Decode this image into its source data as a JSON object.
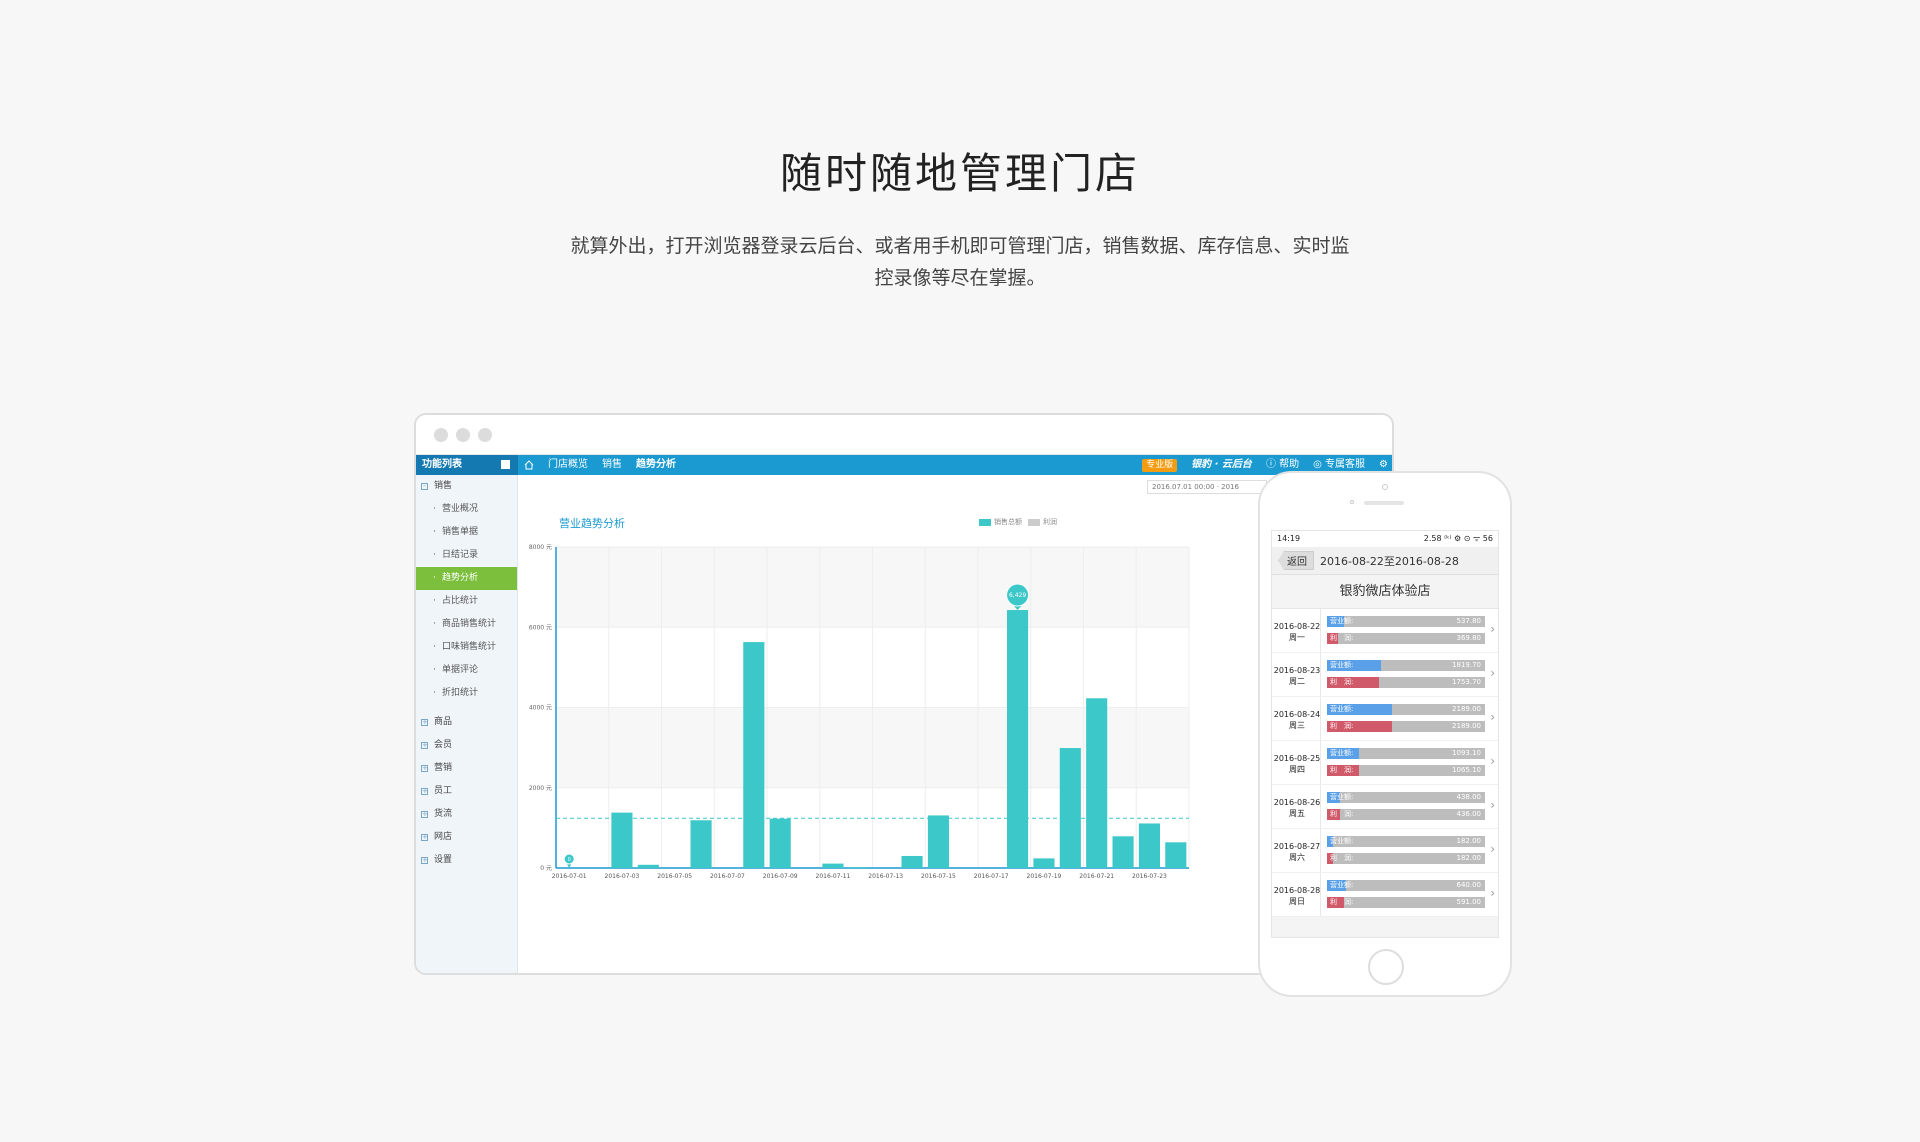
{
  "hero": {
    "title": "随时随地管理门店",
    "subtitle_line1": "就算外出，打开浏览器登录云后台、或者用手机即可管理门店，销售数据、库存信息、实时监",
    "subtitle_line2": "控录像等尽在掌握。"
  },
  "app": {
    "function_list": "功能列表",
    "breadcrumbs": [
      "门店概览",
      "销售",
      "趋势分析"
    ],
    "edition_badge": "专业版",
    "brand": "银豹 · 云后台",
    "help": "帮助",
    "service": "专属客服",
    "date_range_box": "2016.07.01 00:00  ·  2016",
    "colors": {
      "header": "#1b9ad1",
      "active": "#7cbf3d",
      "bar": "#3cc7c9"
    }
  },
  "sidebar": {
    "groups": [
      {
        "label": "销售",
        "expanded": true,
        "children": [
          "营业概况",
          "销售单据",
          "日结记录",
          "趋势分析",
          "占比统计",
          "商品销售统计",
          "口味销售统计",
          "单据评论",
          "折扣统计"
        ],
        "active_child": "趋势分析"
      },
      {
        "label": "商品"
      },
      {
        "label": "会员"
      },
      {
        "label": "营销"
      },
      {
        "label": "员工"
      },
      {
        "label": "货流"
      },
      {
        "label": "网店"
      },
      {
        "label": "设置"
      }
    ]
  },
  "chart_data": {
    "type": "bar",
    "title": "营业趋势分析",
    "legend": [
      "销售总额",
      "利润"
    ],
    "colors": {
      "销售总额": "#3cc7c9",
      "利润": "#cccccc"
    },
    "ylim": [
      0,
      8000
    ],
    "y_ticks": [
      "0 元",
      "2000 元",
      "4000 元",
      "6000 元",
      "8000 元"
    ],
    "x_tick_labels": [
      "2016-07-01",
      "2016-07-03",
      "2016-07-05",
      "2016-07-07",
      "2016-07-09",
      "2016-07-11",
      "2016-07-13",
      "2016-07-15",
      "2016-07-17",
      "2016-07-19",
      "2016-07-21",
      "2016-07-23"
    ],
    "categories": [
      "2016-07-01",
      "2016-07-02",
      "2016-07-03",
      "2016-07-04",
      "2016-07-05",
      "2016-07-06",
      "2016-07-07",
      "2016-07-08",
      "2016-07-09",
      "2016-07-10",
      "2016-07-11",
      "2016-07-12",
      "2016-07-13",
      "2016-07-14",
      "2016-07-15",
      "2016-07-16",
      "2016-07-17",
      "2016-07-18",
      "2016-07-19",
      "2016-07-20",
      "2016-07-21",
      "2016-07-22",
      "2016-07-23"
    ],
    "series": [
      {
        "name": "销售总额",
        "values": [
          0,
          0,
          1380,
          80,
          0,
          1190,
          0,
          5630,
          1230,
          0,
          110,
          20,
          0,
          300,
          1310,
          0,
          0,
          6429,
          240,
          2990,
          4230,
          790,
          1110,
          640
        ]
      }
    ],
    "average_line": 1240,
    "annotations": [
      {
        "category": "2016-07-01",
        "label": "0"
      },
      {
        "category": "2016-07-18",
        "label": "6,429"
      }
    ]
  },
  "phone": {
    "time": "14:19",
    "status_right": "2.58 ⁽ᵏ⁾  ⚙ ⊙  ᯤ  56",
    "back": "返回",
    "date_range": "2016-08-22至2016-08-28",
    "store": "银豹微店体验店",
    "revenue_label": "营业额:",
    "profit_label": "利　润:",
    "days": [
      {
        "date": "2016-08-22",
        "weekday": "周一",
        "revenue": "537.80",
        "profit": "369.80",
        "rev_pct": 0.11,
        "pro_pct": 0.07
      },
      {
        "date": "2016-08-23",
        "weekday": "周二",
        "revenue": "1819.70",
        "profit": "1753.70",
        "rev_pct": 0.34,
        "pro_pct": 0.33
      },
      {
        "date": "2016-08-24",
        "weekday": "周三",
        "revenue": "2189.00",
        "profit": "2189.00",
        "rev_pct": 0.41,
        "pro_pct": 0.41
      },
      {
        "date": "2016-08-25",
        "weekday": "周四",
        "revenue": "1093.10",
        "profit": "1065.10",
        "rev_pct": 0.2,
        "pro_pct": 0.2
      },
      {
        "date": "2016-08-26",
        "weekday": "周五",
        "revenue": "438.00",
        "profit": "436.00",
        "rev_pct": 0.08,
        "pro_pct": 0.08
      },
      {
        "date": "2016-08-27",
        "weekday": "周六",
        "revenue": "182.00",
        "profit": "182.00",
        "rev_pct": 0.04,
        "pro_pct": 0.04
      },
      {
        "date": "2016-08-28",
        "weekday": "周日",
        "revenue": "640.00",
        "profit": "591.00",
        "rev_pct": 0.12,
        "pro_pct": 0.11
      }
    ]
  }
}
